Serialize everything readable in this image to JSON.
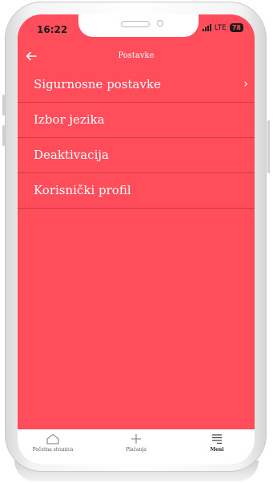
{
  "status_bar": {
    "time": "16:22",
    "network": "LTE",
    "battery": "78"
  },
  "header": {
    "title": "Postavke",
    "back_icon": "back-arrow-icon"
  },
  "menu": {
    "items": [
      {
        "label": "Sigurnosne postavke",
        "has_chevron": true
      },
      {
        "label": "Izbor jezika"
      },
      {
        "label": "Deaktivacija"
      },
      {
        "label": "Korisnički profil"
      }
    ],
    "chevron": "›"
  },
  "tab_bar": {
    "items": [
      {
        "label": "Početna stranica",
        "icon": "home-icon"
      },
      {
        "label": "Plaćanja",
        "icon": "plus-icon"
      },
      {
        "label": "Meni",
        "icon": "menu-icon",
        "active": true
      }
    ]
  },
  "colors": {
    "accent": "#ff4d5c",
    "text_on_accent": "#ffffff",
    "tab_bar_bg": "#ffffff"
  }
}
